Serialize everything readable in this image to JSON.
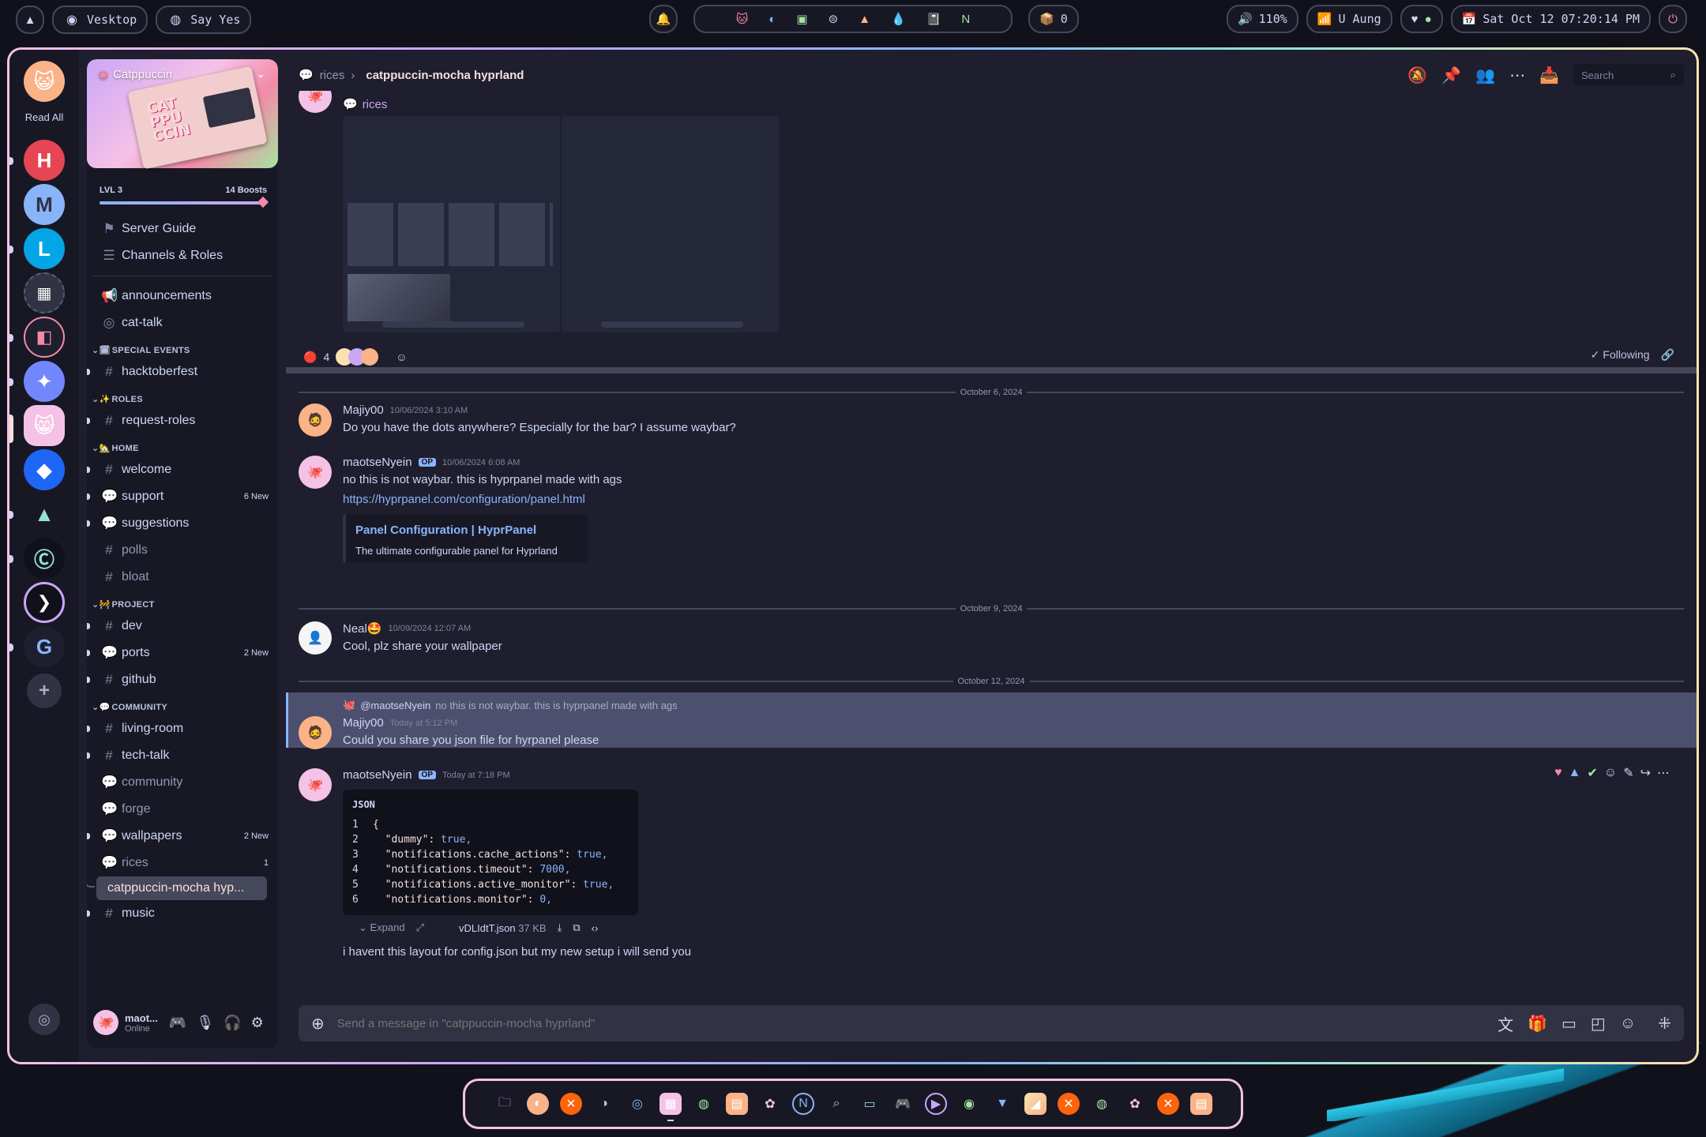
{
  "topbar": {
    "left": [
      {
        "icon": "arch-icon"
      },
      {
        "icon": "discord-icon",
        "label": "Vesktop"
      },
      {
        "icon": "spotify-icon",
        "label": "Say Yes"
      }
    ],
    "workspace_count": "0",
    "volume": "110%",
    "wifi": "U Aung",
    "clock": "Sat Oct 12  07:20:14 PM"
  },
  "rail": {
    "read_all": "Read All",
    "servers": [
      "H",
      "M",
      "L",
      "",
      "",
      "",
      "",
      "",
      "",
      "",
      "",
      "",
      ""
    ],
    "add": "+"
  },
  "server": {
    "name": "Catppuccin",
    "banner_text": "CAT PPU CCIN",
    "level": "LVL 3",
    "boosts": "14 Boosts",
    "level_progress": 0.98,
    "guide": "Server Guide",
    "channels_roles": "Channels & Roles"
  },
  "channels": {
    "top": [
      {
        "name": "announcements",
        "glyph": "📢"
      },
      {
        "name": "cat-talk",
        "glyph": "◎"
      }
    ],
    "categories": [
      {
        "label": "SPECIAL EVENTS",
        "glyph": "🗓",
        "items": [
          {
            "name": "hacktoberfest",
            "glyph": "#",
            "dot": true
          }
        ]
      },
      {
        "label": "ROLES",
        "glyph": "✨",
        "items": [
          {
            "name": "request-roles",
            "glyph": "#",
            "dot": true
          }
        ]
      },
      {
        "label": "HOME",
        "glyph": "🏡",
        "items": [
          {
            "name": "welcome",
            "glyph": "#",
            "dot": true
          },
          {
            "name": "support",
            "glyph": "💬",
            "dot": true,
            "badge": "6 New"
          },
          {
            "name": "suggestions",
            "glyph": "💬",
            "dot": true
          },
          {
            "name": "polls",
            "glyph": "#",
            "muted": true
          },
          {
            "name": "bloat",
            "glyph": "#",
            "muted": true
          }
        ]
      },
      {
        "label": "PROJECT",
        "glyph": "🚧",
        "items": [
          {
            "name": "dev",
            "glyph": "#",
            "dot": true
          },
          {
            "name": "ports",
            "glyph": "💬",
            "dot": true,
            "badge": "2 New"
          },
          {
            "name": "github",
            "glyph": "#",
            "dot": true
          }
        ]
      },
      {
        "label": "COMMUNITY",
        "glyph": "💬",
        "items": [
          {
            "name": "living-room",
            "glyph": "#",
            "dot": true
          },
          {
            "name": "tech-talk",
            "glyph": "#",
            "dot": true
          },
          {
            "name": "community",
            "glyph": "💬",
            "muted": true
          },
          {
            "name": "forge",
            "glyph": "💬",
            "muted": true
          },
          {
            "name": "wallpapers",
            "glyph": "💬",
            "dot": true,
            "badge": "2 New"
          },
          {
            "name": "rices",
            "glyph": "💬",
            "muted": true,
            "badge": "1"
          }
        ]
      }
    ],
    "thread": "catppuccin-mocha hyp...",
    "last": {
      "name": "music",
      "glyph": "#",
      "dot": true
    }
  },
  "user": {
    "name": "maot...",
    "status": "Online"
  },
  "header": {
    "parent": "rices",
    "title": "catppuccin-mocha hyprland",
    "search_placeholder": "Search"
  },
  "post": {
    "tag": "rices",
    "reaction_count": "4",
    "following": "Following"
  },
  "dates": [
    "October 6, 2024",
    "October 9, 2024",
    "October 12, 2024"
  ],
  "messages": [
    {
      "author": "Majiy00",
      "time": "10/06/2024 3:10 AM",
      "text": "Do you have the dots anywhere? Especially for the bar? I assume waybar?"
    },
    {
      "author": "maotseNyein",
      "op": "OP",
      "time": "10/06/2024 6:08 AM",
      "text": "no this is not waybar. this is hyprpanel made with ags",
      "link": "https://hyprpanel.com/configuration/panel.html",
      "embed_title": "Panel Configuration | HyprPanel",
      "embed_desc": "The ultimate configurable panel for Hyprland"
    },
    {
      "author": "Neal🤩",
      "time": "10/09/2024 12:07 AM",
      "text": "Cool, plz share your wallpaper"
    },
    {
      "reply_to": "@maotseNyein",
      "reply_text": "no this is not waybar. this is hyprpanel made with ags",
      "author": "Majiy00",
      "time": "Today at 5:12 PM",
      "text": "Could you share you json file for hyrpanel please"
    },
    {
      "author": "maotseNyein",
      "op": "OP",
      "time": "Today at 7:18 PM",
      "text": "i havent this layout for config.json but my new setup  i will send you"
    }
  ],
  "code": {
    "lang": "JSON",
    "lines": [
      {
        "n": "1",
        "k": "{",
        "v": ""
      },
      {
        "n": "2",
        "k": "  \"dummy\": ",
        "v": "true,"
      },
      {
        "n": "3",
        "k": "  \"notifications.cache_actions\": ",
        "v": "true,"
      },
      {
        "n": "4",
        "k": "  \"notifications.timeout\": ",
        "v": "7000,"
      },
      {
        "n": "5",
        "k": "  \"notifications.active_monitor\": ",
        "v": "true,"
      },
      {
        "n": "6",
        "k": "  \"notifications.monitor\": ",
        "v": "0,"
      }
    ],
    "expand": "Expand",
    "filename": "vDLIdtT.json",
    "filesize": "37 KB"
  },
  "composer": {
    "placeholder": "Send a message in \"catppuccin-mocha hyprland\""
  },
  "colors": {
    "base": "#1e1e2e",
    "mantle": "#181825",
    "crust": "#11111b",
    "text": "#cdd6f4",
    "blue": "#89b4fa",
    "mauve": "#cba6f7",
    "pink": "#f5c2e7"
  }
}
